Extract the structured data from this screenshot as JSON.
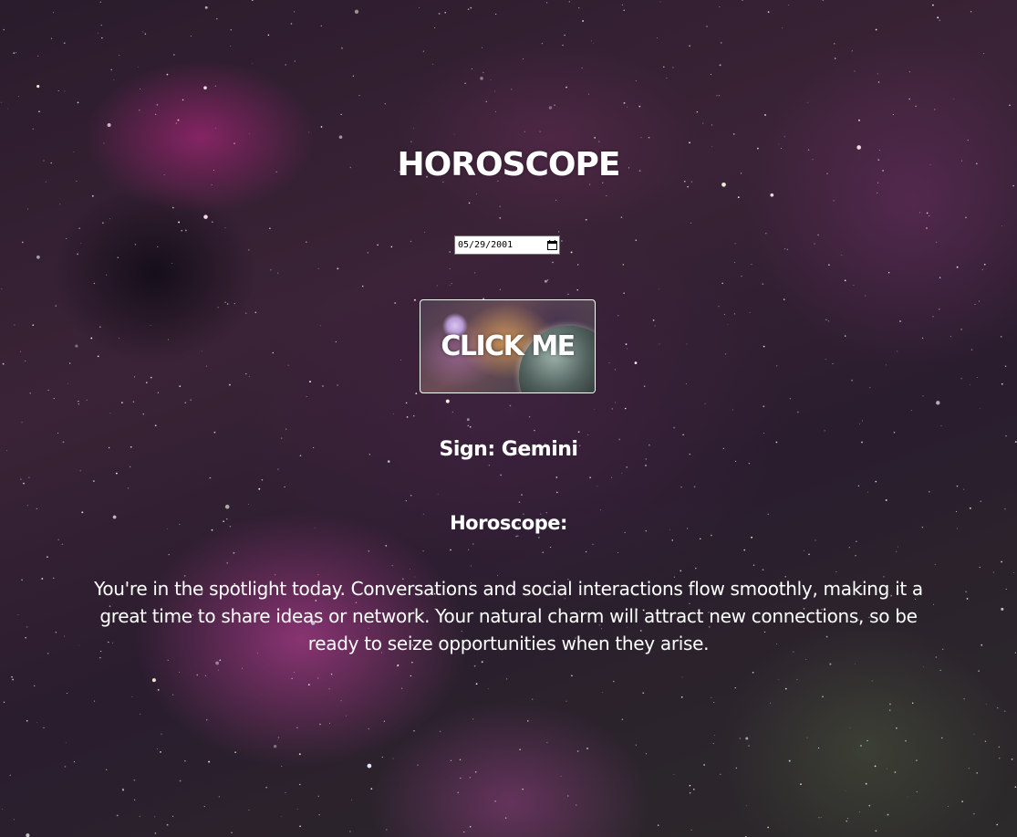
{
  "page": {
    "title": "HOROSCOPE"
  },
  "date_input": {
    "value": "05/29/2001"
  },
  "button": {
    "label": "CLICK ME"
  },
  "result": {
    "sign_text": "Sign: Gemini",
    "horoscope_label": "Horoscope:",
    "horoscope_text": "You're in the spotlight today. Conversations and social interactions flow smoothly, making it a great time to share ideas or network. Your natural charm will attract new connections, so be ready to seize opportunities when they arise."
  },
  "icons": {
    "date_picker": "calendar-icon"
  },
  "colors": {
    "text": "#ffffff",
    "background": "#2a1c2c",
    "nebula": "#c8288c"
  }
}
